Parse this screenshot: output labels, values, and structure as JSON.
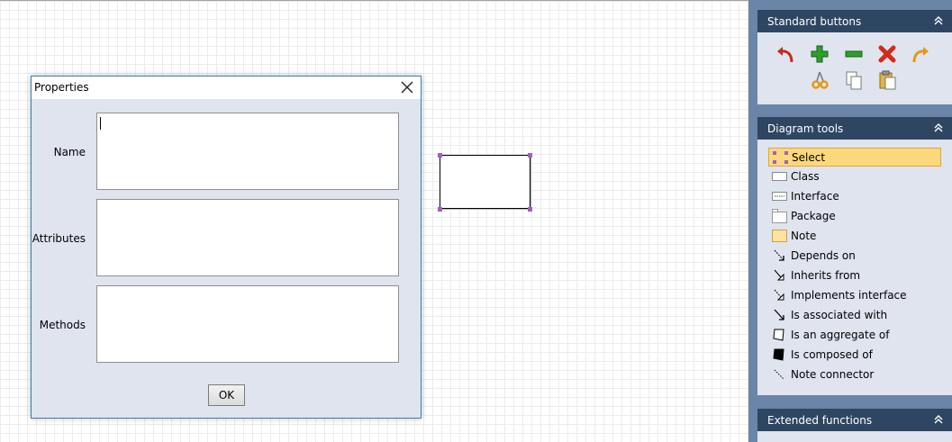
{
  "dialog": {
    "title": "Properties",
    "fields": [
      {
        "label": "Name"
      },
      {
        "label": "Attributes"
      },
      {
        "label": "Methods"
      }
    ],
    "ok_label": "OK"
  },
  "panel": {
    "standard_buttons": {
      "header": "Standard buttons",
      "buttons": [
        "undo-icon",
        "add-icon",
        "remove-icon",
        "delete-icon",
        "redo-icon",
        "cut-icon",
        "copy-icon",
        "paste-icon"
      ]
    },
    "diagram_tools": {
      "header": "Diagram tools",
      "items": [
        {
          "label": "Select",
          "icon": "select-icon",
          "selected": true
        },
        {
          "label": "Class",
          "icon": "class-icon"
        },
        {
          "label": "Interface",
          "icon": "interface-icon"
        },
        {
          "label": "Package",
          "icon": "package-icon"
        },
        {
          "label": "Note",
          "icon": "note-icon"
        },
        {
          "label": "Depends on",
          "icon": "depends-arrow-icon"
        },
        {
          "label": "Inherits from",
          "icon": "inherits-arrow-icon"
        },
        {
          "label": "Implements interface",
          "icon": "implements-arrow-icon"
        },
        {
          "label": "Is associated with",
          "icon": "association-arrow-icon"
        },
        {
          "label": "Is an aggregate of",
          "icon": "aggregate-icon"
        },
        {
          "label": "Is composed of",
          "icon": "composition-icon"
        },
        {
          "label": "Note connector",
          "icon": "note-connector-icon"
        }
      ]
    },
    "extended_functions": {
      "header": "Extended functions"
    }
  },
  "colors": {
    "panel_bg": "#6a85a8",
    "section_header": "#2f4663",
    "section_body": "#dfe4ef",
    "selected_bg": "#fbd87c",
    "handle": "#a25fc0"
  }
}
